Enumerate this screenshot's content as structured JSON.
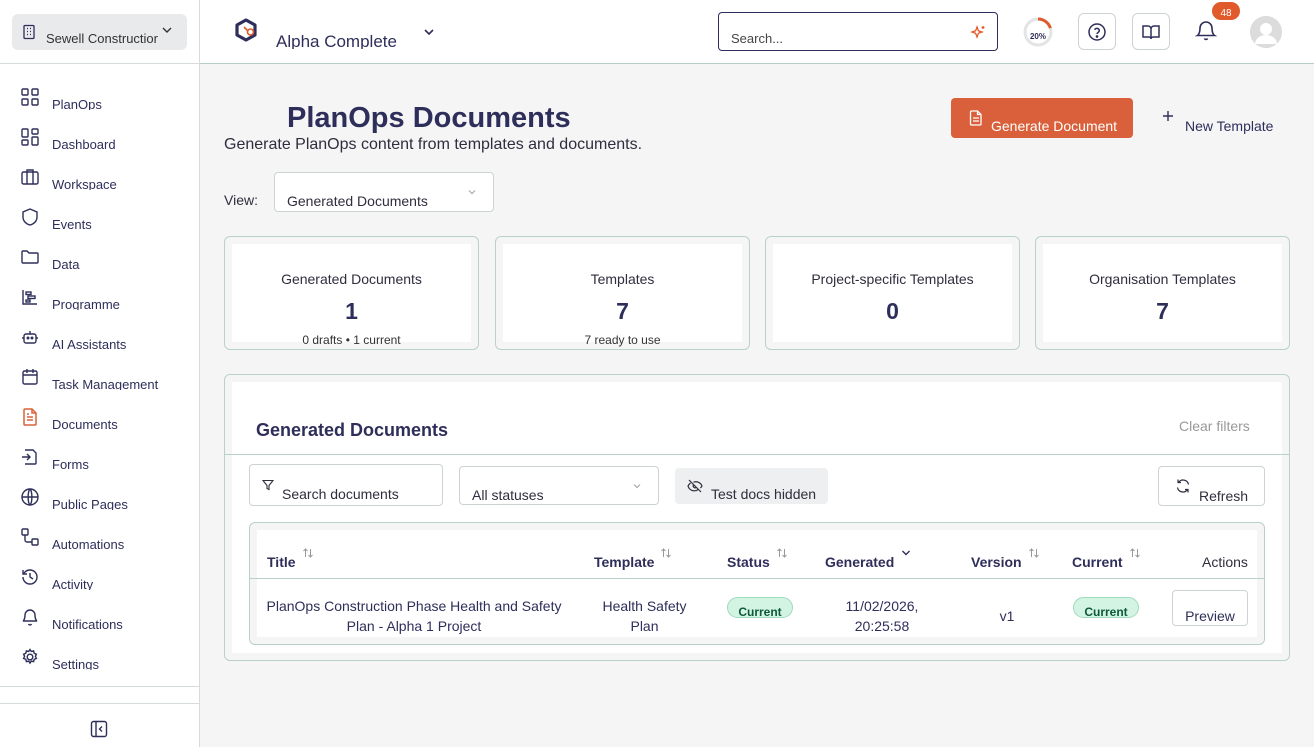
{
  "sidebar": {
    "org_name": "Sewell Construction",
    "items": [
      {
        "label": "PlanOps",
        "icon": "grid-icon"
      },
      {
        "label": "Dashboard",
        "icon": "grid-icon"
      },
      {
        "label": "Workspace",
        "icon": "briefcase-icon"
      },
      {
        "label": "Events",
        "icon": "shield-icon"
      },
      {
        "label": "Data",
        "icon": "folder-icon"
      },
      {
        "label": "Programme",
        "icon": "gantt-icon"
      },
      {
        "label": "AI Assistants",
        "icon": "bot-icon"
      },
      {
        "label": "Task Management",
        "icon": "calendar-icon"
      },
      {
        "label": "Documents",
        "icon": "document-icon",
        "active": true
      },
      {
        "label": "Forms",
        "icon": "form-icon"
      },
      {
        "label": "Public Pages",
        "icon": "globe-icon"
      },
      {
        "label": "Automations",
        "icon": "workflow-icon"
      },
      {
        "label": "Activity",
        "icon": "history-icon"
      },
      {
        "label": "Notifications",
        "icon": "bell-icon"
      },
      {
        "label": "Settings",
        "icon": "gear-icon"
      }
    ]
  },
  "topbar": {
    "project_name": "Alpha Complete",
    "search_placeholder": "Search...",
    "progress_label": "20%",
    "progress_value": 0.2,
    "notification_count": "48"
  },
  "page": {
    "title": "PlanOps Documents",
    "subtitle": "Generate PlanOps content from templates and documents.",
    "generate_button": "Generate Document",
    "new_template_button": "New Template",
    "view_label": "View:",
    "view_value": "Generated Documents"
  },
  "stats": [
    {
      "title": "Generated Documents",
      "value": "1",
      "sub": "0 drafts • 1 current"
    },
    {
      "title": "Templates",
      "value": "7",
      "sub": "7 ready to use"
    },
    {
      "title": "Project-specific Templates",
      "value": "0",
      "sub": ""
    },
    {
      "title": "Organisation Templates",
      "value": "7",
      "sub": ""
    }
  ],
  "panel": {
    "title": "Generated Documents",
    "clear_filters": "Clear filters",
    "search_placeholder": "Search documents",
    "status_filter": "All statuses",
    "test_docs": "Test docs hidden",
    "refresh": "Refresh"
  },
  "table": {
    "headers": {
      "title": "Title",
      "template": "Template",
      "status": "Status",
      "generated": "Generated",
      "version": "Version",
      "current": "Current",
      "actions": "Actions"
    },
    "rows": [
      {
        "title_line1": "PlanOps Construction Phase Health and Safety",
        "title_line2": "Plan - Alpha 1 Project",
        "template_line1": "Health Safety",
        "template_line2": "Plan",
        "status": "Current",
        "generated_line1": "11/02/2026,",
        "generated_line2": "20:25:58",
        "version": "v1",
        "current": "Current",
        "action": "Preview"
      }
    ]
  },
  "colors": {
    "accent": "#d9603a",
    "navy": "#2e2e5a",
    "border_green": "#b9d2c9",
    "pill_bg": "#d3f3e3"
  }
}
